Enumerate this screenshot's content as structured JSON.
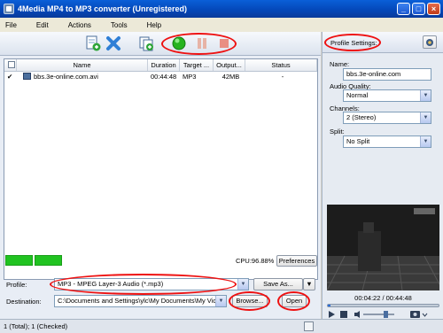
{
  "window": {
    "title": "4Media MP4 to MP3 converter (Unregistered)",
    "min": "_",
    "max": "□",
    "close": "×"
  },
  "menu": [
    "File",
    "Edit",
    "Actions",
    "Tools",
    "Help"
  ],
  "grid": {
    "headers": [
      "Name",
      "Duration",
      "Target ...",
      "Output...",
      "Status"
    ],
    "rows": [
      {
        "name": "bbs.3e-online.com.avi",
        "duration": "00:44:48",
        "target": "MP3",
        "output": "42MB",
        "status": "-"
      }
    ]
  },
  "progress": {
    "segments_filled": 2,
    "cpu": "CPU:96.88%",
    "preferences": "Preferences"
  },
  "profile": {
    "label": "Profile:",
    "value": "MP3 - MPEG Layer-3 Audio (*.mp3)",
    "save_as": "Save As..."
  },
  "destination": {
    "label": "Destination:",
    "value": "C:\\Documents and Settings\\ylc\\My Documents\\My Video:",
    "browse": "Browse...",
    "open": "Open"
  },
  "status": {
    "text": "1 (Total); 1 (Checked)"
  },
  "settings": {
    "title": "Profile Settings:",
    "name_label": "Name:",
    "name_value": "bbs.3e-online.com",
    "quality_label": "Audio Quality:",
    "quality_value": "Normal",
    "channels_label": "Channels:",
    "channels_value": "2 (Stereo)",
    "split_label": "Split:",
    "split_value": "No Split"
  },
  "player": {
    "time": "00:04:22 / 00:44:48",
    "progress_fraction": 0.02
  },
  "colors": {
    "title_bar": "#0a5fd8",
    "progress_green": "#21c321",
    "annotation_red": "#e11111"
  }
}
